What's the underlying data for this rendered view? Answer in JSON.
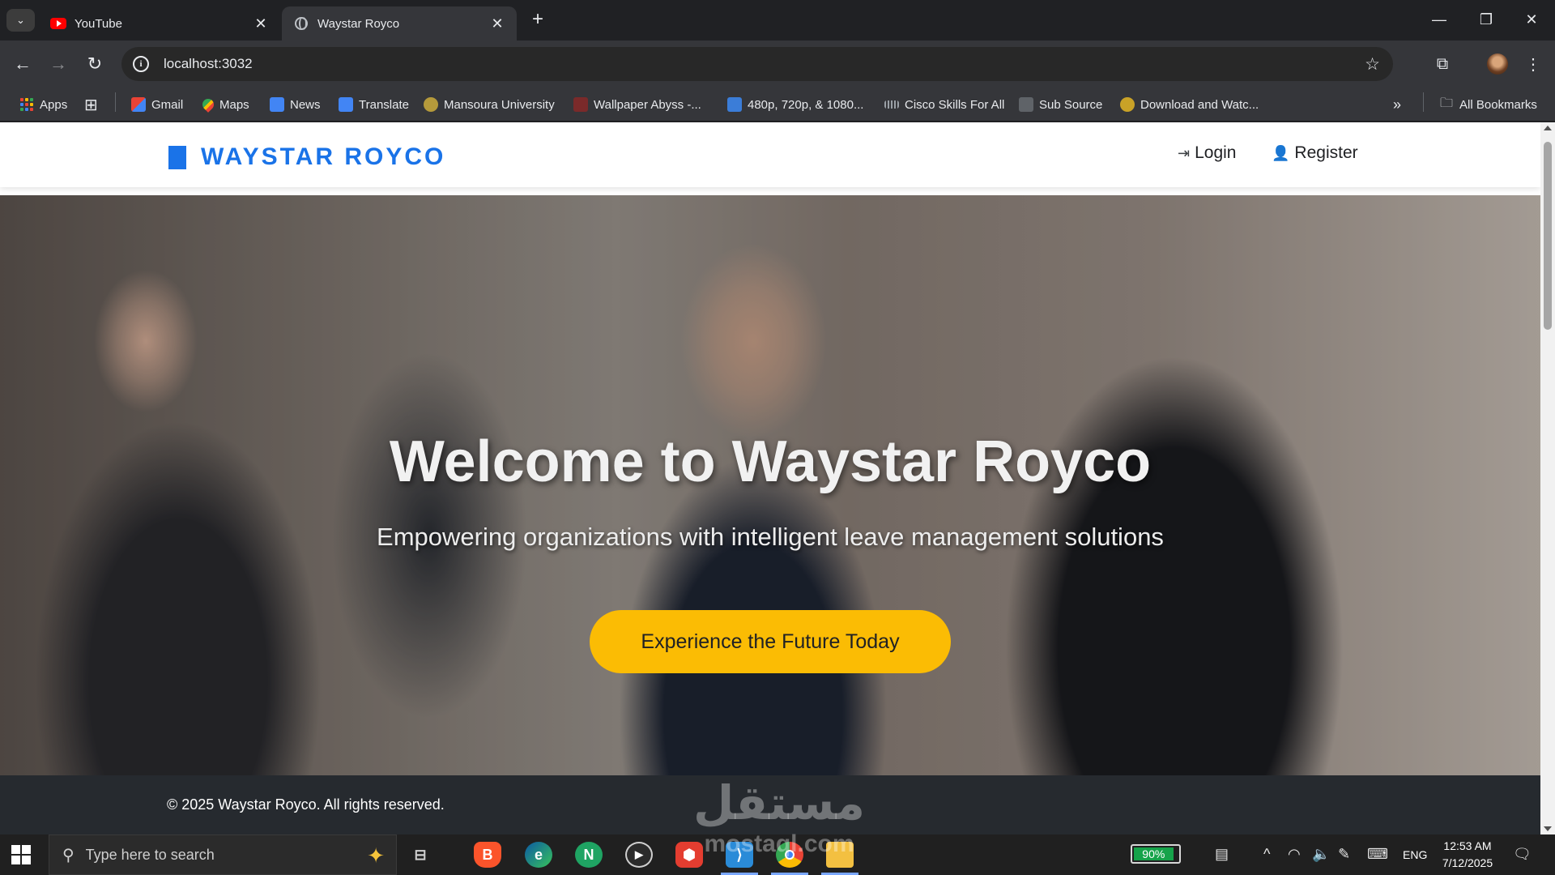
{
  "browser": {
    "tabs": [
      {
        "title": "YouTube",
        "close": "✕"
      },
      {
        "title": "Waystar Royco",
        "close": "✕"
      }
    ],
    "new_tab": "+",
    "window_controls": {
      "minimize": "—",
      "restore": "❐",
      "close": "✕"
    },
    "nav": {
      "back": "←",
      "forward": "→",
      "reload": "↻"
    },
    "address": {
      "url": "localhost:3032",
      "info": "i",
      "star": "☆"
    },
    "toolbar_icons": {
      "extensions": "⧉",
      "menu": "⋮"
    },
    "bookmarks": [
      {
        "label": "Apps"
      },
      {
        "label": "Gmail"
      },
      {
        "label": "Maps"
      },
      {
        "label": "News"
      },
      {
        "label": "Translate"
      },
      {
        "label": "Mansoura University"
      },
      {
        "label": "Wallpaper Abyss -..."
      },
      {
        "label": "480p, 720p, & 1080..."
      },
      {
        "label": "Cisco Skills For All"
      },
      {
        "label": "Sub Source"
      },
      {
        "label": "Download and Watc..."
      }
    ],
    "bookmarks_overflow": "»",
    "all_bookmarks": "All Bookmarks"
  },
  "site": {
    "brand": "WAYSTAR ROYCO",
    "nav": {
      "login": "Login",
      "register": "Register"
    },
    "hero": {
      "title": "Welcome to Waystar Royco",
      "subtitle": "Empowering organizations with intelligent leave management solutions",
      "cta": "Experience the Future Today"
    },
    "footer": "© 2025 Waystar Royco. All rights reserved.",
    "watermark": "مستقل",
    "watermark_sub": "mostaql.com"
  },
  "colors": {
    "brand_blue": "#1a73e8",
    "cta_yellow": "#fbbc04",
    "footer_bg": "#262a2f"
  },
  "taskbar": {
    "search_placeholder": "Type here to search",
    "battery": "90%",
    "language": "ENG",
    "time": "12:53 AM",
    "date": "7/12/2025",
    "apps": [
      "brave-icon",
      "edge-icon",
      "n-app-icon",
      "media-player-icon",
      "office-icon",
      "vscode-icon",
      "chrome-icon",
      "file-explorer-icon"
    ]
  }
}
